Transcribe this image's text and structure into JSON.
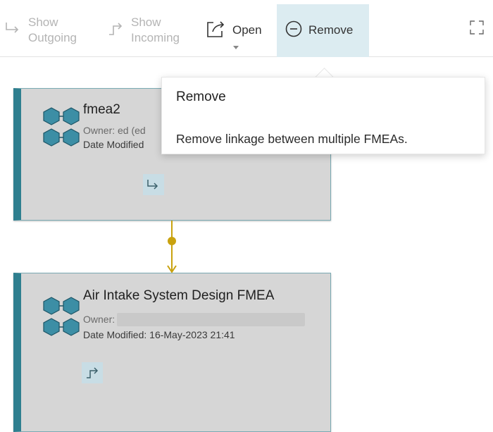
{
  "toolbar": {
    "show_outgoing": {
      "line1": "Show",
      "line2": "Outgoing",
      "icon": "arrow-turn-right-icon",
      "enabled": false
    },
    "show_incoming": {
      "line1": "Show",
      "line2": "Incoming",
      "icon": "arrow-turn-up-right-icon",
      "enabled": false
    },
    "open": {
      "label": "Open",
      "icon": "open-external-icon"
    },
    "remove": {
      "label": "Remove",
      "icon": "minus-circle-icon",
      "active": true
    },
    "expand_icon": "fullscreen-icon"
  },
  "tooltip": {
    "title": "Remove",
    "description": "Remove linkage between multiple FMEAs."
  },
  "nodes": [
    {
      "title": "fmea2",
      "owner": "Owner: ed (ed",
      "date_modified": "Date Modified",
      "icon": "fmea-hexagon-icon",
      "action_icon": "show-outgoing-icon"
    },
    {
      "title": "Air Intake System Design FMEA",
      "owner": "Owner:",
      "date_modified": "Date Modified: 16-May-2023 21:41",
      "icon": "fmea-hexagon-icon",
      "action_icon": "show-incoming-icon"
    }
  ],
  "colors": {
    "accent": "#2f7f8f",
    "active_bg": "#dcecf1",
    "connector": "#c9a20f",
    "node_bg": "#d6d6d6"
  }
}
